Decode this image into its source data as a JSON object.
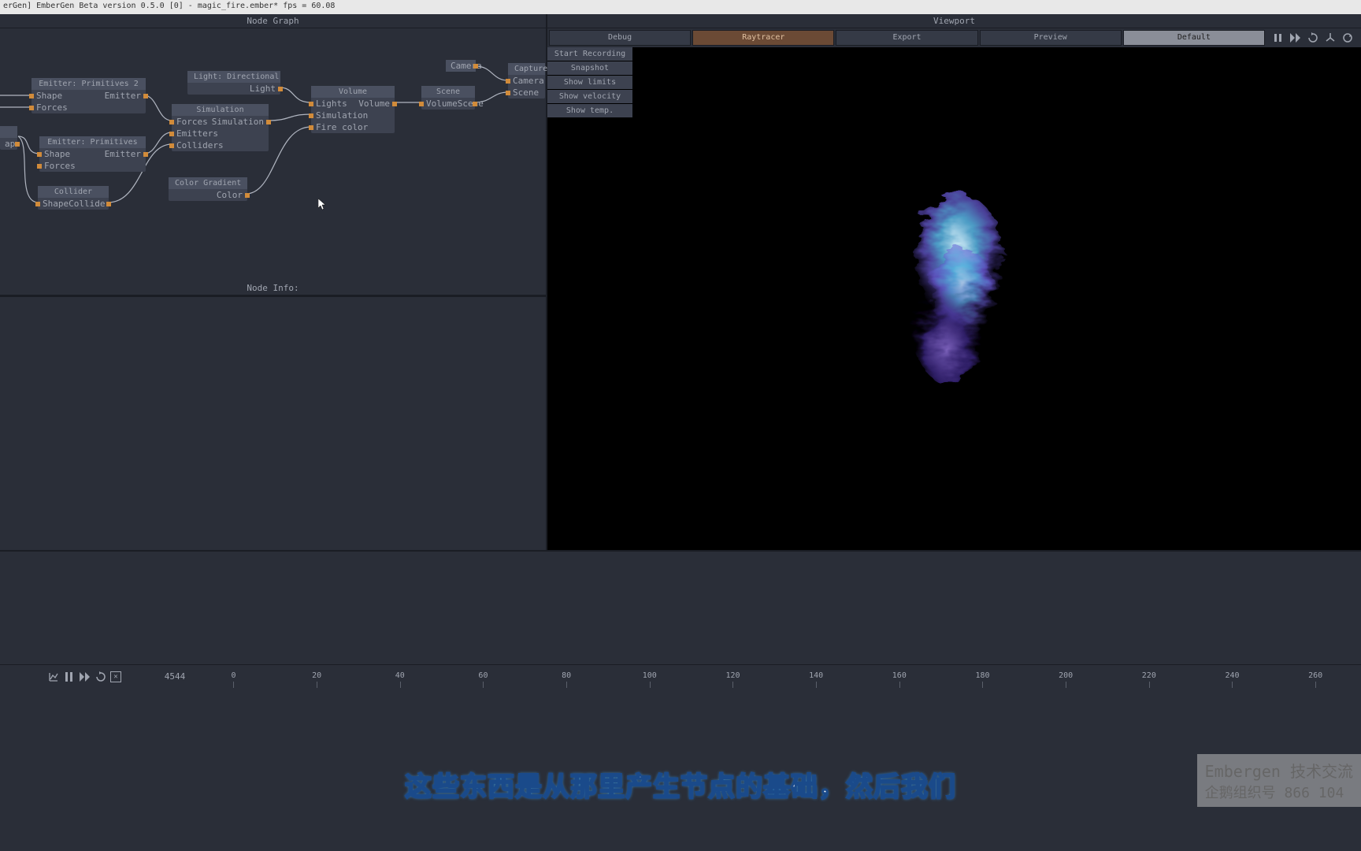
{
  "titlebar": "erGen] EmberGen Beta version 0.5.0 [0] - magic_fire.ember*    fps = 60.08",
  "panels": {
    "node_graph": "Node Graph",
    "node_info": "Node Info:",
    "viewport": "Viewport"
  },
  "nodes": {
    "emitter_p2": {
      "title": "Emitter: Primitives 2",
      "shape": "Shape",
      "emitter": "Emitter",
      "forces": "Forces"
    },
    "emitter_p": {
      "title": "Emitter: Primitives",
      "shape": "Shape",
      "emitter": "Emitter",
      "forces": "Forces"
    },
    "collider": {
      "title": "Collider",
      "shape": "Shape",
      "out": "Collider"
    },
    "light": {
      "title": "Light: Directional",
      "out": "Light"
    },
    "simulation": {
      "title": "Simulation",
      "forces": "Forces",
      "out": "Simulation",
      "emitters": "Emitters",
      "colliders": "Colliders"
    },
    "color_grad": {
      "title": "Color Gradient",
      "out": "Color"
    },
    "volume": {
      "title": "Volume",
      "lights": "Lights",
      "out": "Volume",
      "sim": "Simulation",
      "fire": "Fire color"
    },
    "scene": {
      "title": "Scene",
      "volume": "Volume",
      "out": "Scene"
    },
    "camera": {
      "title": "Camera",
      "out": "Camera"
    },
    "capture": {
      "title": "Capture",
      "camera": "Camera",
      "scene": "Scene"
    },
    "shape_frag": {
      "out": "ape"
    }
  },
  "viewport_tabs": {
    "debug": "Debug",
    "raytracer": "Raytracer",
    "export": "Export",
    "preview": "Preview",
    "default": "Default"
  },
  "side_buttons": [
    "Start Recording",
    "Snapshot",
    "Show limits",
    "Show velocity",
    "Show temp."
  ],
  "timeline": {
    "frame": "4544",
    "ticks": [
      "0",
      "20",
      "40",
      "60",
      "80",
      "100",
      "120",
      "140",
      "160",
      "180",
      "200",
      "220",
      "240",
      "260"
    ]
  },
  "subtitle": "这些东西是从那里产生节点的基础，然后我们",
  "watermark": {
    "l1": "Embergen  技术交流",
    "l2": "企鹅组织号 866 104"
  }
}
